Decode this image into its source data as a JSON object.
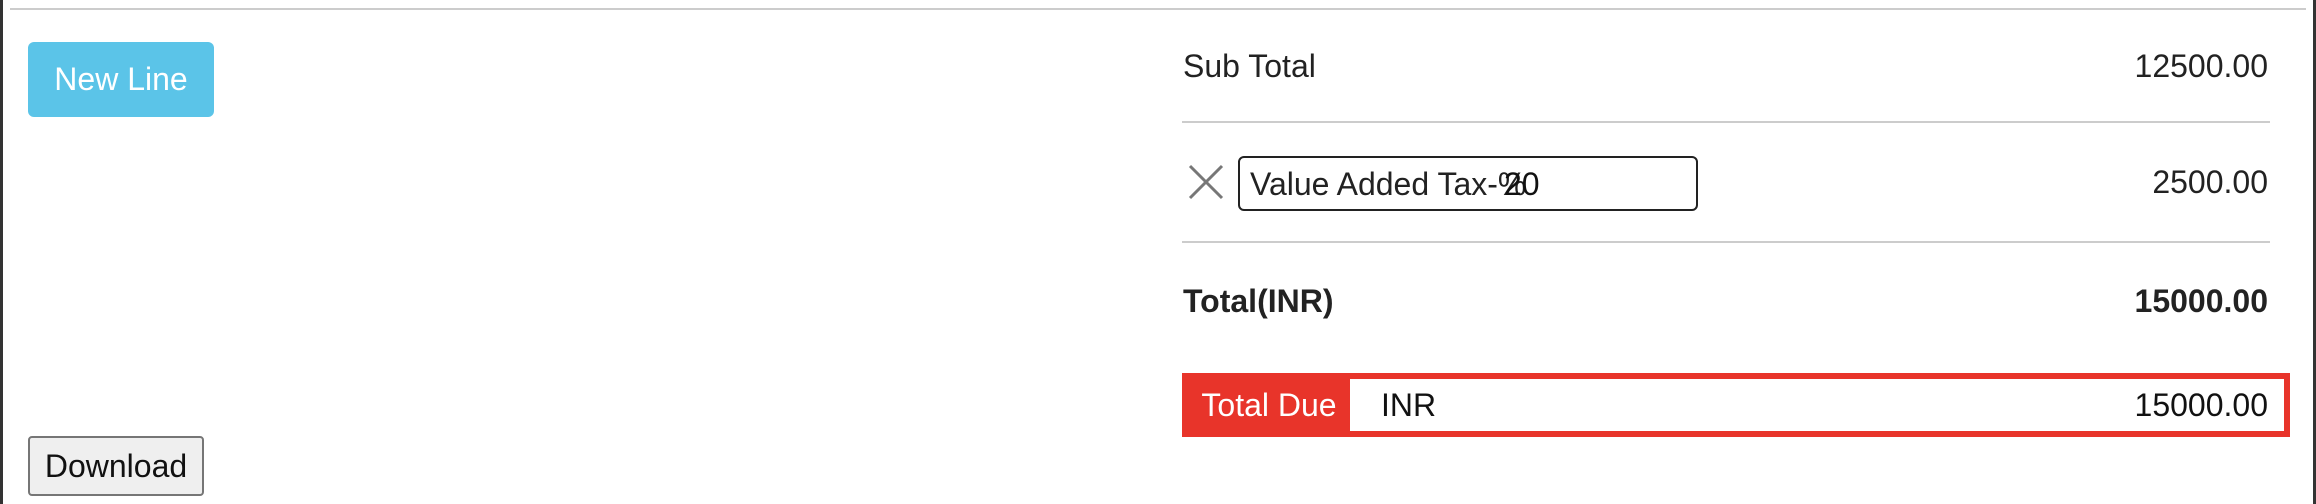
{
  "actions": {
    "new_line_label": "New Line",
    "download_label": "Download"
  },
  "summary": {
    "subtotal_label": "Sub Total",
    "subtotal_amount": "12500.00",
    "tax": {
      "name": "Value Added Tax-%",
      "rate": "20",
      "amount": "2500.00",
      "remove_icon": "close-icon"
    },
    "total_label": "Total(INR)",
    "total_amount": "15000.00",
    "due": {
      "label": "Total Due",
      "currency": "INR",
      "amount": "15000.00"
    }
  },
  "colors": {
    "new_line_button": "#5bc4e8",
    "total_due_accent": "#e8342a"
  }
}
